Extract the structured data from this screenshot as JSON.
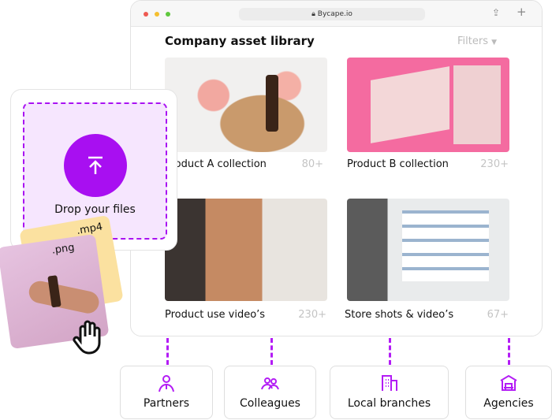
{
  "browser": {
    "url": "Bycape.io",
    "traffic_lights": [
      "#ee5a52",
      "#f5bf2f",
      "#5fc83e"
    ]
  },
  "library": {
    "title": "Company asset library",
    "filters_label": "Filters",
    "items": [
      {
        "label": "Product A collection",
        "count": "80+"
      },
      {
        "label": "Product B collection",
        "count": "230+"
      },
      {
        "label": "Product use video’s",
        "count": "230+"
      },
      {
        "label": "Store shots & video’s",
        "count": "67+"
      }
    ]
  },
  "upload": {
    "label": "Drop your files",
    "files": [
      ".mp4",
      ".png"
    ]
  },
  "destinations": [
    {
      "label": "Partners",
      "icon": "person-icon"
    },
    {
      "label": "Colleagues",
      "icon": "people-icon"
    },
    {
      "label": "Local branches",
      "icon": "building-icon"
    },
    {
      "label": "Agencies",
      "icon": "agency-icon"
    }
  ],
  "colors": {
    "accent": "#a80ff1",
    "dropzone": "#f6e6fe"
  }
}
